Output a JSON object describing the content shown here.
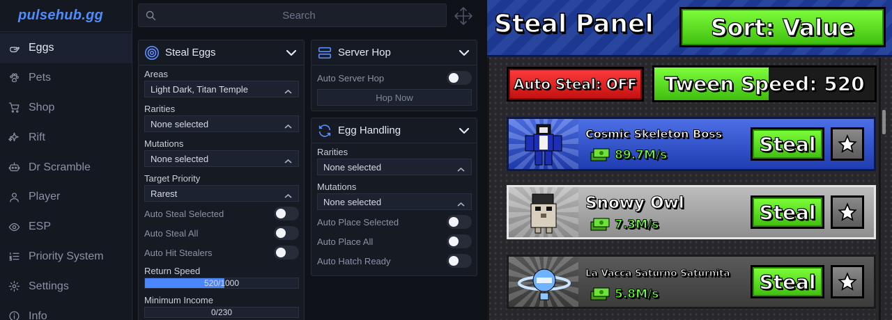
{
  "app": {
    "logo": "pulsehub.gg"
  },
  "search": {
    "placeholder": "Search"
  },
  "sidebar": {
    "items": [
      {
        "label": "Eggs",
        "icon": "hand-icon",
        "active": true
      },
      {
        "label": "Pets",
        "icon": "paw-icon"
      },
      {
        "label": "Shop",
        "icon": "cart-icon"
      },
      {
        "label": "Rift",
        "icon": "sparkle-icon"
      },
      {
        "label": "Dr Scramble",
        "icon": "robot-icon"
      },
      {
        "label": "Player",
        "icon": "person-icon"
      },
      {
        "label": "ESP",
        "icon": "eye-icon"
      },
      {
        "label": "Priority System",
        "icon": "list-icon"
      },
      {
        "label": "Settings",
        "icon": "gear-icon"
      },
      {
        "label": "Info",
        "icon": "info-icon"
      }
    ]
  },
  "steal_eggs": {
    "title": "Steal Eggs",
    "areas_label": "Areas",
    "areas_value": "Light Dark, Titan Temple",
    "rarities_label": "Rarities",
    "rarities_value": "None selected",
    "mutations_label": "Mutations",
    "mutations_value": "None selected",
    "priority_label": "Target Priority",
    "priority_value": "Rarest",
    "auto_steal_selected": "Auto Steal Selected",
    "auto_steal_all": "Auto Steal All",
    "auto_hit_stealers": "Auto Hit Stealers",
    "return_speed_label": "Return Speed",
    "return_speed_value": "520/1000",
    "return_speed_fraction": 0.52,
    "min_income_label": "Minimum Income",
    "min_income_value": "0/230",
    "min_income_fraction": 0
  },
  "server_hop": {
    "title": "Server Hop",
    "auto_server_hop": "Auto Server Hop",
    "hop_now": "Hop Now"
  },
  "egg_handling": {
    "title": "Egg Handling",
    "rarities_label": "Rarities",
    "rarities_value": "None selected",
    "mutations_label": "Mutations",
    "mutations_value": "None selected",
    "auto_place_selected": "Auto Place Selected",
    "auto_place_all": "Auto Place All",
    "auto_hatch_ready": "Auto Hatch Ready"
  },
  "game": {
    "title": "Steal Panel",
    "sort_button": "Sort: Value",
    "auto_steal_button": "Auto Steal: OFF",
    "tween_speed": "Tween Speed: 520",
    "tween_fraction": 0.52,
    "steal_label": "Steal",
    "pets": [
      {
        "name": "Cosmic Skeleton Boss",
        "rate": "89.7M/s",
        "style": "blue"
      },
      {
        "name": "Snowy Owl",
        "rate": "7.3M/s",
        "style": "gray"
      },
      {
        "name": "La Vacca Saturno Saturnita",
        "rate": "5.8M/s",
        "style": "dark"
      }
    ]
  },
  "colors": {
    "accent": "#4c86ff",
    "green": "#3fbd0f",
    "red": "#c10f0f"
  }
}
